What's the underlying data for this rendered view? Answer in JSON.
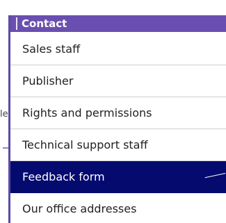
{
  "menu": {
    "header": "Contact",
    "items": [
      {
        "label": "Sales staff"
      },
      {
        "label": "Publisher"
      },
      {
        "label": "Rights and permissions"
      },
      {
        "label": "Technical support staff"
      },
      {
        "label": "Feedback form",
        "active": true
      },
      {
        "label": "Our office addresses"
      }
    ]
  },
  "background": {
    "left_fragment": "le"
  },
  "colors": {
    "header_bg": "#6a4fb0",
    "active_bg": "#050a6e",
    "border": "#5a4aa8"
  }
}
